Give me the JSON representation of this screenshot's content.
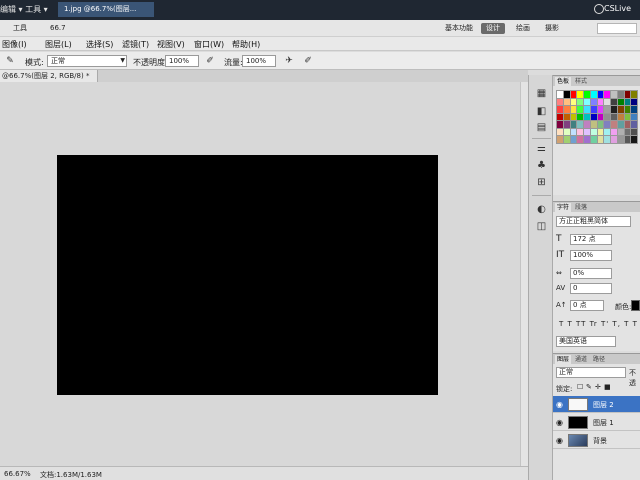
{
  "appbar": {
    "menu_left": "编辑 ▾ 工具 ▾",
    "tab_title": "1.jpg @66.7%(图层...",
    "workspaces": [
      "基本功能",
      "设计",
      "绘画",
      "摄影"
    ],
    "active_workspace": "设计",
    "cs_label": "CSLive"
  },
  "topstrip": {
    "items": [
      "工具",
      "66.7",
      "▾"
    ]
  },
  "menubar": {
    "items": [
      "图像(I)",
      "图层(L)",
      "选择(S)",
      "滤镜(T)",
      "视图(V)",
      "窗口(W)",
      "帮助(H)"
    ]
  },
  "options": {
    "mode_label": "模式:",
    "mode_value": "正常",
    "opacity_label": "不透明度:",
    "opacity_value": "100%",
    "flow_label": "流量:",
    "flow_value": "100%"
  },
  "document": {
    "tab_label": "@66.7%(图层 2, RGB/8) *"
  },
  "status": {
    "zoom": "66.67%",
    "doc_info": "文档:1.63M/1.63M"
  },
  "swatch_panel": {
    "tabs": [
      "色板",
      "样式"
    ]
  },
  "char_panel": {
    "tabs": [
      "字符",
      "段落"
    ],
    "font_family": "方正正粗黑简体",
    "font_size": "172 点",
    "scale": "100%",
    "tracking": "0%",
    "kerning": "0",
    "baseline": "0 点",
    "color_label": "颜色:",
    "language": "美国英语",
    "style_buttons": "T T TT Tr T' T, T T"
  },
  "layers_panel": {
    "tabs": [
      "图层",
      "通道",
      "路径"
    ],
    "blend_mode": "正常",
    "opacity_label": "不透",
    "lock_label": "锁定:",
    "layers": [
      {
        "name": "图层 2",
        "selected": true
      },
      {
        "name": "图层 1",
        "selected": false
      },
      {
        "name": "背景",
        "selected": false
      }
    ]
  },
  "colors": {
    "swatches": [
      "#ffffff",
      "#000000",
      "#ff0000",
      "#ffff00",
      "#00ff00",
      "#00ffff",
      "#0000ff",
      "#ff00ff",
      "#c0c0c0",
      "#808080",
      "#800000",
      "#808000",
      "#ff8080",
      "#ffc080",
      "#ffff80",
      "#80ff80",
      "#80ffff",
      "#8080ff",
      "#ff80ff",
      "#e0e0e0",
      "#404040",
      "#008000",
      "#008080",
      "#000080",
      "#ff4040",
      "#ff8040",
      "#ffe040",
      "#40ff40",
      "#40e0ff",
      "#4040ff",
      "#e040ff",
      "#a0a0a0",
      "#202020",
      "#804000",
      "#408000",
      "#004080",
      "#c00000",
      "#c06000",
      "#c0c000",
      "#00c000",
      "#00c0c0",
      "#0000c0",
      "#c000c0",
      "#909090",
      "#606060",
      "#c08040",
      "#80c040",
      "#4080c0",
      "#800040",
      "#804080",
      "#408080",
      "#80c0c0",
      "#c080c0",
      "#c0c080",
      "#80c080",
      "#8080c0",
      "#c08080",
      "#60a0a0",
      "#a06060",
      "#6060a0",
      "#ffe0c0",
      "#e0ffc0",
      "#c0e0ff",
      "#ffc0e0",
      "#e0c0ff",
      "#c0ffe0",
      "#f0f0a0",
      "#a0f0f0",
      "#f0a0f0",
      "#b0b0b0",
      "#707070",
      "#505050",
      "#d0a070",
      "#a0d070",
      "#70a0d0",
      "#d070a0",
      "#a070d0",
      "#70d0a0",
      "#e0e0a0",
      "#a0e0e0",
      "#e0a0e0",
      "#989898",
      "#585858",
      "#181818"
    ]
  }
}
